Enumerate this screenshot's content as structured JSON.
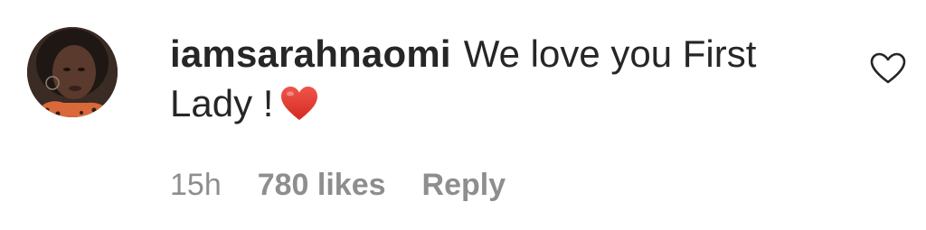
{
  "comment": {
    "username": "iamsarahnaomi",
    "text": "We love you First Lady !",
    "emoji_icon": "red-heart-emoji",
    "time": "15h",
    "likes": "780 likes",
    "reply_label": "Reply",
    "like_icon": "heart-outline-icon"
  },
  "colors": {
    "text": "#262626",
    "meta": "#8e8e8e",
    "heart": "#e0322d"
  }
}
